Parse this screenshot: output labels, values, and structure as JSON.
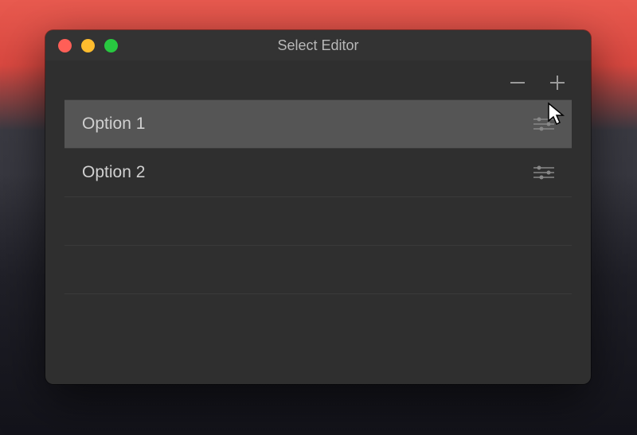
{
  "window": {
    "title": "Select Editor"
  },
  "toolbar": {
    "remove_label": "Remove",
    "add_label": "Add"
  },
  "list": {
    "rows": [
      {
        "label": "Option 1",
        "selected": true,
        "hasSettings": true
      },
      {
        "label": "Option 2",
        "selected": false,
        "hasSettings": true
      },
      {
        "label": "",
        "selected": false,
        "hasSettings": false
      },
      {
        "label": "",
        "selected": false,
        "hasSettings": false
      }
    ]
  }
}
